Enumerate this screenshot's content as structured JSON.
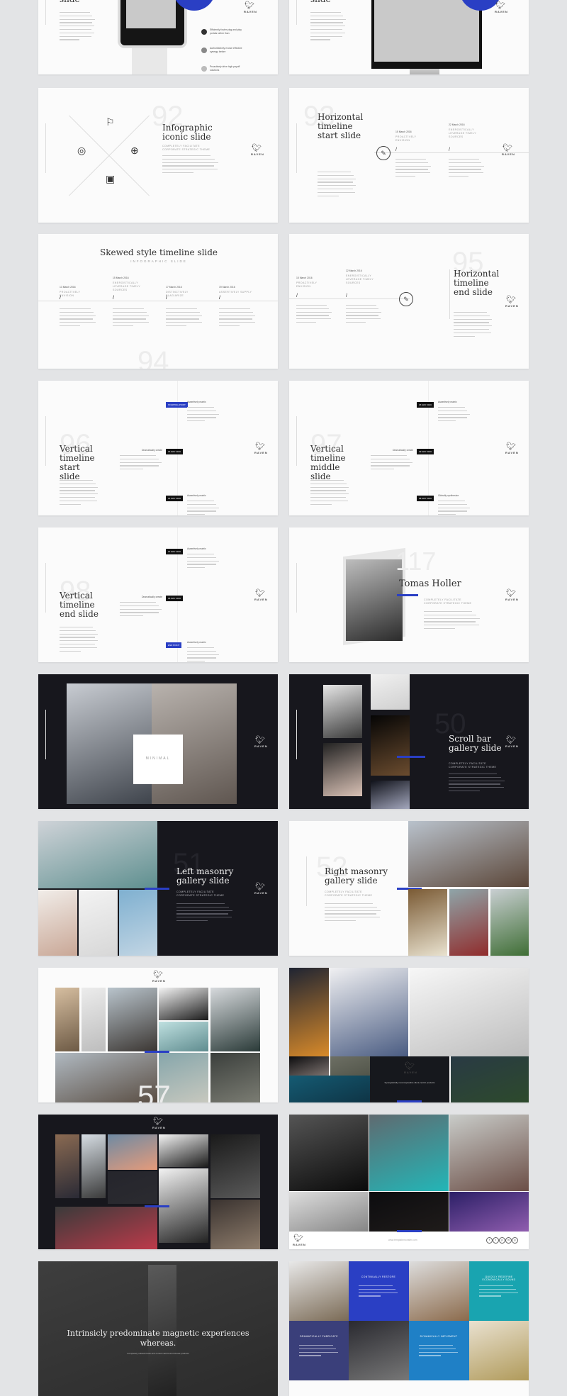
{
  "brand": {
    "logo_text": "RAVEN"
  },
  "colors": {
    "accent": "#2a3fc4",
    "dark_bg": "#17171d",
    "light_bg": "#fbfbfb",
    "page_bg": "#e3e4e6",
    "teal": "#19a4b0"
  },
  "slides": [
    {
      "kind": "watch",
      "theme": "light",
      "title": "slide",
      "bullets": [
        "Efficiently foster plug and play portals rather than",
        "Authoritatively evolve effective synergy before",
        "Proactively drive high payoff solutions"
      ]
    },
    {
      "kind": "monitor",
      "theme": "light",
      "title": "slide"
    },
    {
      "kind": "infographic",
      "theme": "light",
      "number": "92",
      "title": "Infographic iconic slide",
      "subtitle": "Completely facilitate corporate strategic theme"
    },
    {
      "kind": "hstart",
      "theme": "light",
      "number": "93",
      "title": "Horizontal timeline start slide",
      "dates": [
        "15 March 2016",
        "22 March 2016"
      ],
      "headings": [
        "Proactively envision",
        "Energistically leverage timely sources"
      ]
    },
    {
      "kind": "skewed",
      "theme": "light",
      "number": "94",
      "title": "Skewed style timeline slide",
      "subtitle": "Infographic slide",
      "dates": [
        "13 March 2016",
        "15 March 2016",
        "17 March 2016",
        "19 March 2016"
      ],
      "headings": [
        "Proactively envision",
        "Energistically leverage timely sources",
        "Distinctively plagiarize",
        "Assertively supply"
      ]
    },
    {
      "kind": "hend",
      "theme": "light",
      "number": "95",
      "title": "Horizontal timeline end slide",
      "dates": [
        "15 March 2016",
        "22 March 2016"
      ],
      "headings": [
        "Proactively envision",
        "Energistically leverage timely sources"
      ]
    },
    {
      "kind": "vertical",
      "theme": "light",
      "number": "96",
      "title": "Vertical timeline start slide",
      "tags": [
        "STARTING POINT",
        "15 MAY 2016",
        "21 MAY 2016"
      ],
      "tag_colors": [
        "blue",
        "black",
        "black"
      ],
      "headings": [
        "Assertively matrix",
        "Dramatically create",
        "Assertively matrix"
      ]
    },
    {
      "kind": "vertical",
      "theme": "light",
      "number": "97",
      "title": "Vertical timeline middle slide",
      "tags": [
        "15 MAY 2016",
        "29 MAY 2016",
        "08 MAY 2016"
      ],
      "tag_colors": [
        "black",
        "black",
        "black"
      ],
      "headings": [
        "Assertively matrix",
        "Dramatically create",
        "Globally synthesize"
      ]
    },
    {
      "kind": "vertical",
      "theme": "light",
      "number": "98",
      "title": "Vertical timeline end slide",
      "tags": [
        "07 MAY 2016",
        "05 MAY 2016",
        "END POINT"
      ],
      "tag_colors": [
        "black",
        "black",
        "blue"
      ],
      "headings": [
        "Assertively matrix",
        "Dramatically create",
        "Assertively matrix"
      ]
    },
    {
      "kind": "person",
      "theme": "light",
      "number": "117",
      "title": "Tomas Holler",
      "subtitle": "Completely facilitate corporate strategic theme"
    },
    {
      "kind": "minimal",
      "theme": "dark",
      "label": "MINIMAL"
    },
    {
      "kind": "scroll",
      "theme": "dark",
      "number": "50",
      "title": "Scroll bar gallery slide",
      "subtitle": "Completely facilitate corporate strategic theme"
    },
    {
      "kind": "leftmasonry",
      "theme": "dark",
      "number": "51",
      "title": "Left masonry gallery slide",
      "subtitle": "Completely facilitate corporate strategic theme"
    },
    {
      "kind": "rightmasonry",
      "theme": "light",
      "number": "52",
      "title": "Right masonry gallery slide",
      "subtitle": "Completely facilitate corporate strategic theme"
    },
    {
      "kind": "grid57",
      "theme": "light",
      "number": "57"
    },
    {
      "kind": "collage",
      "theme": "light",
      "caption": "Synergistically reconceptualize client-centric products"
    },
    {
      "kind": "darkgrid",
      "theme": "dark"
    },
    {
      "kind": "footergrid",
      "theme": "light",
      "url": "www.templatemonster.com",
      "social": [
        "f",
        "t",
        "p",
        "in",
        "g"
      ]
    },
    {
      "kind": "quote",
      "theme": "dark",
      "quote": "Intrinsicly predominate magnetic experiences whereas.",
      "caption": "Completely unleash back-end content with best-of-breed products"
    },
    {
      "kind": "tiles",
      "theme": "light",
      "tiles": [
        "CONTINUALLY RESTORE",
        "QUICKLY REDEFINE ECONOMICALLY SOUND",
        "DRAMATICALLY FABRICATE",
        "DYNAMICALLY IMPLEMENT"
      ]
    }
  ]
}
